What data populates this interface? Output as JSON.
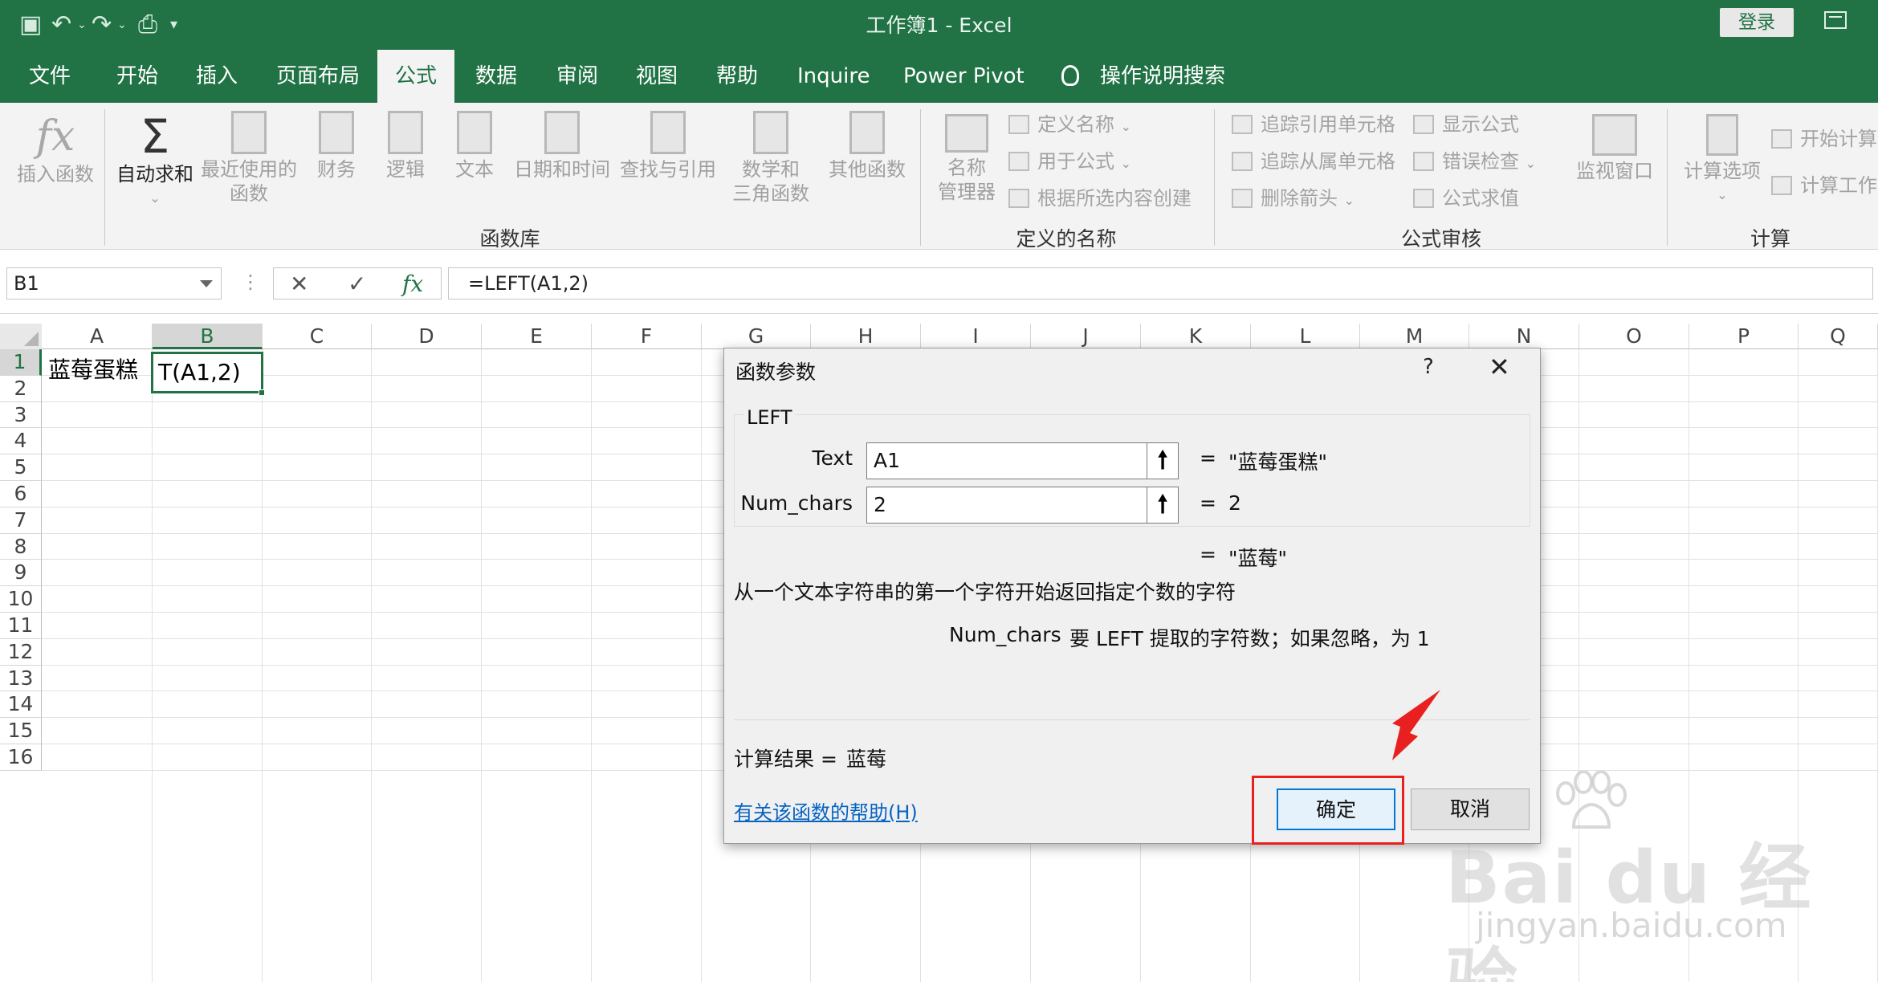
{
  "titlebar": {
    "title": "工作簿1  -  Excel",
    "login_label": "登录",
    "bg_color": "#217346"
  },
  "tabs": [
    {
      "label": "文件"
    },
    {
      "label": "开始"
    },
    {
      "label": "插入"
    },
    {
      "label": "页面布局"
    },
    {
      "label": "公式",
      "active": true
    },
    {
      "label": "数据"
    },
    {
      "label": "审阅"
    },
    {
      "label": "视图"
    },
    {
      "label": "帮助"
    },
    {
      "label": "Inquire"
    },
    {
      "label": "Power Pivot"
    }
  ],
  "search_tab": {
    "label": "操作说明搜索",
    "icon": "lightbulb-icon"
  },
  "ribbon": {
    "function_library": {
      "group_label": "函数库",
      "insert_function": "插入函数",
      "autosum": "自动求和",
      "recent_1": "最近使用的",
      "recent_2": "函数",
      "financial": "财务",
      "logical": "逻辑",
      "text": "文本",
      "datetime": "日期和时间",
      "lookup": "查找与引用",
      "math_1": "数学和",
      "math_2": "三角函数",
      "other": "其他函数"
    },
    "defined_names": {
      "group_label": "定义的名称",
      "name_manager_1": "名称",
      "name_manager_2": "管理器",
      "define_name": "定义名称",
      "use_in_formula": "用于公式",
      "create_from_selection": "根据所选内容创建"
    },
    "formula_auditing": {
      "group_label": "公式审核",
      "trace_precedents": "追踪引用单元格",
      "trace_dependents": "追踪从属单元格",
      "remove_arrows": "删除箭头",
      "show_formulas": "显示公式",
      "error_checking": "错误检查",
      "evaluate_formula": "公式求值",
      "watch_window": "监视窗口"
    },
    "calculation": {
      "group_label": "计算",
      "options": "计算选项",
      "calc_now": "开始计算",
      "calc_sheet": "计算工作"
    }
  },
  "formula_bar": {
    "name_box": "B1",
    "cancel_icon": "✕",
    "enter_icon": "✓",
    "fx_label": "fx",
    "formula": "=LEFT(A1,2)"
  },
  "grid": {
    "columns": [
      "A",
      "B",
      "C",
      "D",
      "E",
      "F",
      "G",
      "H",
      "I",
      "J",
      "K",
      "L",
      "M",
      "N",
      "O",
      "P",
      "Q"
    ],
    "rows": [
      "1",
      "2",
      "3",
      "4",
      "5",
      "6",
      "7",
      "8",
      "9",
      "10",
      "11",
      "12",
      "13",
      "14",
      "15",
      "16"
    ],
    "selected_column": "B",
    "selected_row": "1",
    "cells": {
      "A1": "蓝莓蛋糕",
      "B1": "T(A1,2)"
    }
  },
  "dialog": {
    "title": "函数参数",
    "help": "?",
    "close": "✕",
    "function_name": "LEFT",
    "args": [
      {
        "label": "Text",
        "value": "A1",
        "eq": "=",
        "result": "\"蓝莓蛋糕\""
      },
      {
        "label": "Num_chars",
        "value": "2",
        "eq": "=",
        "result": "2"
      }
    ],
    "overall_eq": "=",
    "overall_result": "\"蓝莓\"",
    "description": "从一个文本字符串的第一个字符开始返回指定个数的字符",
    "arg_name": "Num_chars",
    "arg_description": "要 LEFT 提取的字符数；如果忽略，为 1",
    "result_label": "计算结果 =",
    "result_value": "蓝莓",
    "help_link": "有关该函数的帮助(H)",
    "ok_label": "确定",
    "cancel_label": "取消",
    "highlight_color": "#e8201f"
  },
  "watermark": {
    "logo_text": "Bai du 经验",
    "url": "jingyan.baidu.com"
  }
}
